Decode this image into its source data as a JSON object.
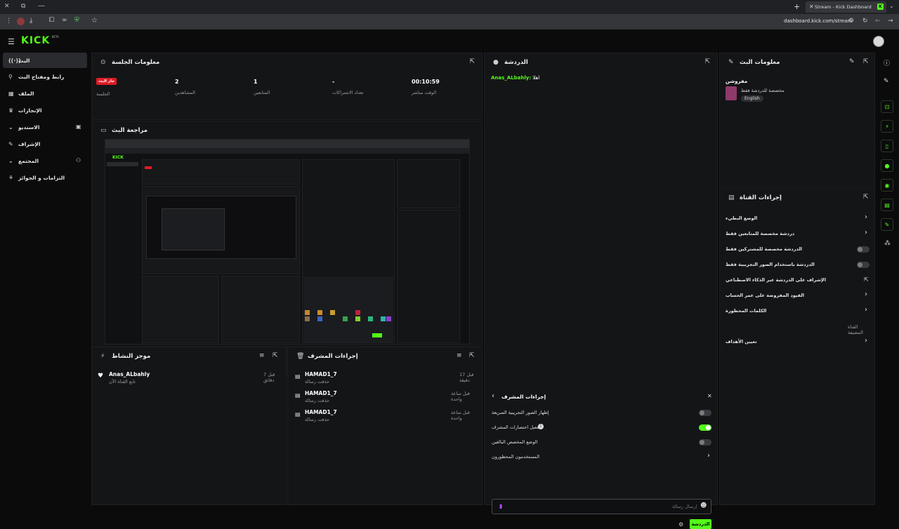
{
  "browser": {
    "tab_title": "Stream - Kick Dashboard",
    "url": "dashboard.kick.com/stream"
  },
  "sidebar": {
    "logo": "KICK",
    "logo_beta": "BETA",
    "items": [
      {
        "label": "البث",
        "icon": "broadcast-icon"
      },
      {
        "label": "رابط ومفتاح البث",
        "icon": "link-icon"
      },
      {
        "label": "الملف",
        "icon": "profile-icon"
      },
      {
        "label": "الإنجازات",
        "icon": "trophy-icon"
      },
      {
        "label": "الاستديو",
        "icon": "studio-icon"
      },
      {
        "label": "الإشراف",
        "icon": "wrench-icon"
      },
      {
        "label": "المجتمع",
        "icon": "community-icon"
      },
      {
        "label": "التزامات و الجوائز",
        "icon": "rewards-icon"
      }
    ]
  },
  "session": {
    "title": "معلومات الجلسة",
    "live_badge": "جار البث",
    "session_label": "الجلسة",
    "stats": [
      {
        "value": "2",
        "label": "المشاهدين"
      },
      {
        "value": "1",
        "label": "المتابعين"
      },
      {
        "value": "-",
        "label": "تعداد الاشتراكات"
      },
      {
        "value": "00:10:59",
        "label": "الوقت مباشر"
      }
    ]
  },
  "preview": {
    "title": "مراجعة البث"
  },
  "activity": {
    "title": "موجز النشاط",
    "items": [
      {
        "user": "Anas_ALbahly",
        "desc": "تابع القناة الآن",
        "time": "قبل 7 دقائق"
      }
    ]
  },
  "modactions": {
    "title": "إجراءات المشرف",
    "items": [
      {
        "user": "HAMAD1_7",
        "desc": "حذفت رسالة",
        "time": "قبل 17 دقيقة"
      },
      {
        "user": "HAMAD1_7",
        "desc": "حذفت رسالة",
        "time": "قبل ساعة واحدة"
      },
      {
        "user": "HAMAD1_7",
        "desc": "حذفت رسالة",
        "time": "قبل ساعة واحدة"
      }
    ]
  },
  "chat": {
    "title": "الدردشة",
    "messages": [
      {
        "user": "Anas_ALbahly:",
        "text": "اهلا"
      }
    ],
    "modpanel": {
      "title": "إجراءات المشرف",
      "rows": [
        {
          "label": "إظهار الصور التجريبية السريعة",
          "type": "toggle",
          "on": false
        },
        {
          "label": "تفعيل اختصارات المشرف",
          "type": "toggle",
          "on": true
        },
        {
          "label": "الوضع المخصص البالغين",
          "type": "toggle",
          "on": false
        },
        {
          "label": "المستخدمون المحظورون",
          "type": "chevron"
        }
      ]
    },
    "input_placeholder": "إرسال رسالة",
    "send_label": "الدردشة"
  },
  "stream_info": {
    "title": "معلومات البث",
    "stream_title": "مفروشن",
    "category": "مخصصة للدردشة فقط",
    "language": "English"
  },
  "channel_actions": {
    "title": "إجراءات القناة",
    "rows": [
      {
        "label": "الوضع البطيء",
        "type": "chevron"
      },
      {
        "label": "دردشة مخصصة للمتابعين فقط",
        "type": "chevron"
      },
      {
        "label": "الدردشة مخصصة للمشتركين فقط",
        "type": "toggle",
        "on": false
      },
      {
        "label": "الدردشة باستخدام الصور التجريبية فقط",
        "type": "toggle",
        "on": false
      },
      {
        "label": "الإشراف على الدردشة عبر الذكاء الاصطناعي",
        "type": "external"
      },
      {
        "label": "القيود المفروضة على عمر الحساب",
        "type": "chevron"
      },
      {
        "label": "الكلمات المحظورة",
        "type": "chevron"
      }
    ],
    "hosted_label": "القناة المضيفة",
    "set_goals": "تعيين الأهداف"
  },
  "colors": {
    "accent": "#53fc18",
    "live": "#e01b24"
  }
}
